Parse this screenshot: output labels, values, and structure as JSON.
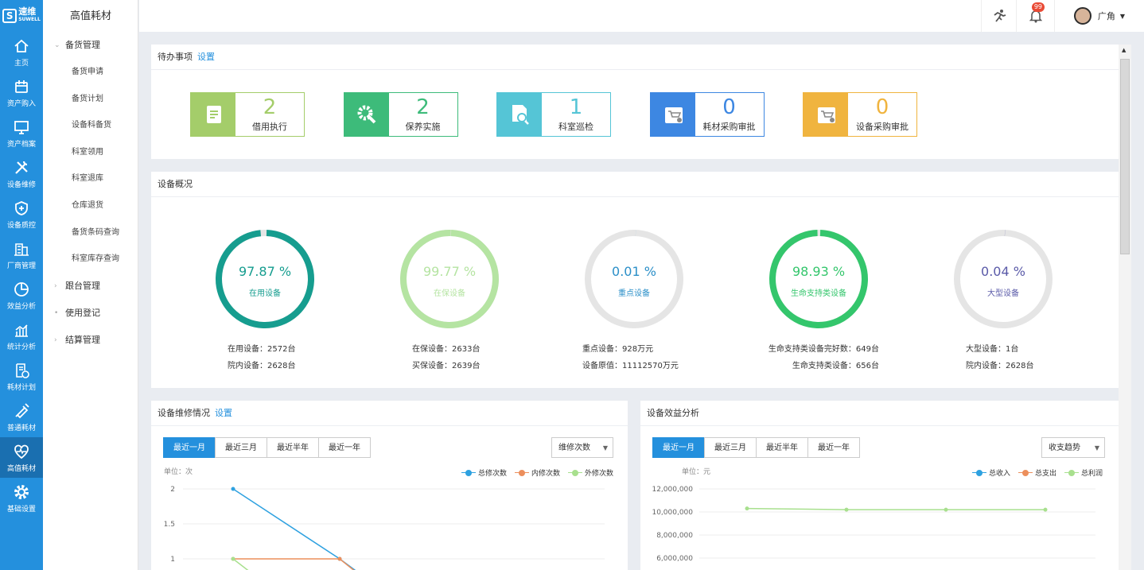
{
  "brand": {
    "name": "速维",
    "sub": "SUWELL"
  },
  "nav": [
    {
      "label": "主页",
      "icon": "home-icon"
    },
    {
      "label": "资产购入",
      "icon": "calendar-icon"
    },
    {
      "label": "资产档案",
      "icon": "monitor-icon"
    },
    {
      "label": "设备维修",
      "icon": "tools-icon"
    },
    {
      "label": "设备质控",
      "icon": "shield-plus-icon"
    },
    {
      "label": "厂商管理",
      "icon": "building-icon"
    },
    {
      "label": "效益分析",
      "icon": "pie-chart-icon"
    },
    {
      "label": "统计分析",
      "icon": "bar-chart-icon"
    },
    {
      "label": "耗材计划",
      "icon": "document-clock-icon"
    },
    {
      "label": "普通耗材",
      "icon": "syringe-icon"
    },
    {
      "label": "高值耗材",
      "icon": "heart-pulse-icon"
    },
    {
      "label": "基础设置",
      "icon": "gear-icon"
    }
  ],
  "submenu": {
    "title": "高值耗材",
    "groups": [
      {
        "label": "备货管理",
        "arrow": "⌄",
        "items": [
          "备货申请",
          "备货计划",
          "设备科备货",
          "科室领用",
          "科室退库",
          "仓库退货",
          "备货条码查询",
          "科室库存查询"
        ]
      },
      {
        "label": "跟台管理",
        "arrow": "›",
        "items": []
      },
      {
        "label": "使用登记",
        "arrow": "•",
        "items": []
      },
      {
        "label": "结算管理",
        "arrow": "›",
        "items": []
      }
    ]
  },
  "topbar": {
    "badge": "99",
    "user": "广角"
  },
  "todo": {
    "title": "待办事项",
    "setting": "设置",
    "cards": [
      {
        "num": "2",
        "label": "借用执行",
        "color": "#a4cd6a",
        "icon": "hand-card-icon"
      },
      {
        "num": "2",
        "label": "保养实施",
        "color": "#3dbb7a",
        "icon": "gear-wrench-icon"
      },
      {
        "num": "1",
        "label": "科室巡检",
        "color": "#55c5d6",
        "icon": "doc-search-icon"
      },
      {
        "num": "0",
        "label": "耗材采购审批",
        "color": "#3d87e2",
        "icon": "cart-user-icon"
      },
      {
        "num": "0",
        "label": "设备采购审批",
        "color": "#f0b43f",
        "icon": "cart-user-icon"
      }
    ]
  },
  "overview": {
    "title": "设备概况",
    "items": [
      {
        "pct": "97.87 %",
        "value": 0.9787,
        "label": "在用设备",
        "color": "#169d8f",
        "notes": [
          "在用设备：2572台",
          "院内设备：2628台"
        ]
      },
      {
        "pct": "99.77 %",
        "value": 0.9977,
        "label": "在保设备",
        "color": "#b5e4a2",
        "notes": [
          "在保设备：2633台",
          "买保设备：2639台"
        ]
      },
      {
        "pct": "0.01 %",
        "value": 0.0001,
        "label": "重点设备",
        "color": "#2b8fc8",
        "notes": [
          "重点设备：928万元",
          "设备原值：11112570万元"
        ]
      },
      {
        "pct": "98.93 %",
        "value": 0.9893,
        "label": "生命支持类设备",
        "color": "#34c66c",
        "notes": [
          "生命支持类设备完好数：649台",
          "生命支持类设备：656台"
        ]
      },
      {
        "pct": "0.04 %",
        "value": 0.0004,
        "label": "大型设备",
        "color": "#5a5aa8",
        "notes": [
          "大型设备：1台",
          "院内设备：2628台"
        ]
      }
    ]
  },
  "repair": {
    "title": "设备维修情况",
    "setting": "设置",
    "tabs": [
      "最近一月",
      "最近三月",
      "最近半年",
      "最近一年"
    ],
    "select": "维修次数",
    "unit": "单位：次",
    "legend": [
      "总修次数",
      "内修次数",
      "外修次数"
    ]
  },
  "benefit": {
    "title": "设备效益分析",
    "tabs": [
      "最近一月",
      "最近三月",
      "最近半年",
      "最近一年"
    ],
    "select": "收支趋势",
    "unit": "单位：元",
    "legend": [
      "总收入",
      "总支出",
      "总利润"
    ]
  },
  "chart_data": [
    {
      "type": "line",
      "ylim": [
        0,
        2
      ],
      "yticks": [
        "2",
        "1.5",
        "1"
      ],
      "series": [
        {
          "name": "总修次数",
          "color": "#2ea1e0",
          "values": [
            2,
            1
          ]
        },
        {
          "name": "内修次数",
          "color": "#ec8f5c",
          "values": [
            1,
            1
          ]
        },
        {
          "name": "外修次数",
          "color": "#a8e08e",
          "values": [
            1
          ]
        }
      ]
    },
    {
      "type": "line",
      "yticks": [
        "12,000,000",
        "10,000,000",
        "8,000,000",
        "6,000,000"
      ],
      "series": [
        {
          "name": "总利润",
          "color": "#a8e08e",
          "values": [
            10300000,
            10200000,
            10200000,
            10200000
          ]
        }
      ]
    }
  ]
}
